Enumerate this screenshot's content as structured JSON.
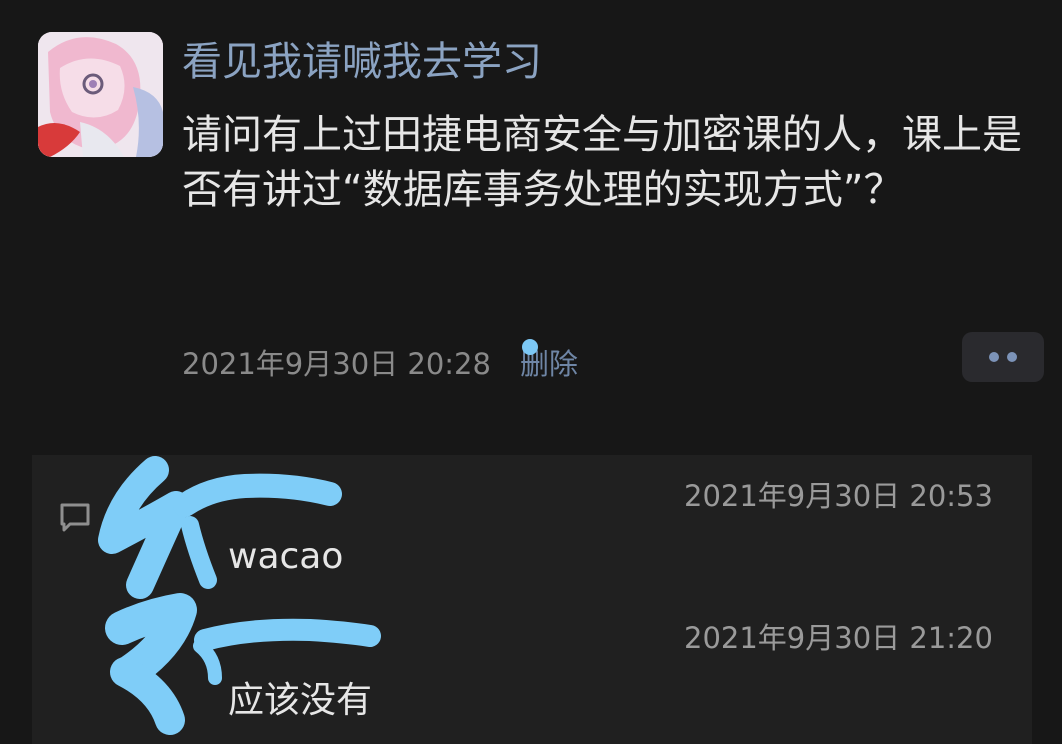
{
  "post": {
    "username": "看见我请喊我去学习",
    "text": "请问有上过田捷电商安全与加密课的人，课上是否有讲过“数据库事务处理的实现方式”？",
    "time": "2021年9月30日 20:28",
    "delete_label": "删除",
    "avatar_icon": "anime-avatar-icon",
    "more_icon": "more-dots-icon"
  },
  "comments": [
    {
      "time": "2021年9月30日 20:53",
      "text": "wacao"
    },
    {
      "time": "2021年9月30日 21:20",
      "text": "应该没有"
    }
  ],
  "colors": {
    "background": "#171717",
    "username": "#8ba3c2",
    "text": "#e6e6e6",
    "muted": "#8a8a8a",
    "link": "#6f86a6",
    "panel": "#202020",
    "redaction": "#7fcdf8"
  }
}
